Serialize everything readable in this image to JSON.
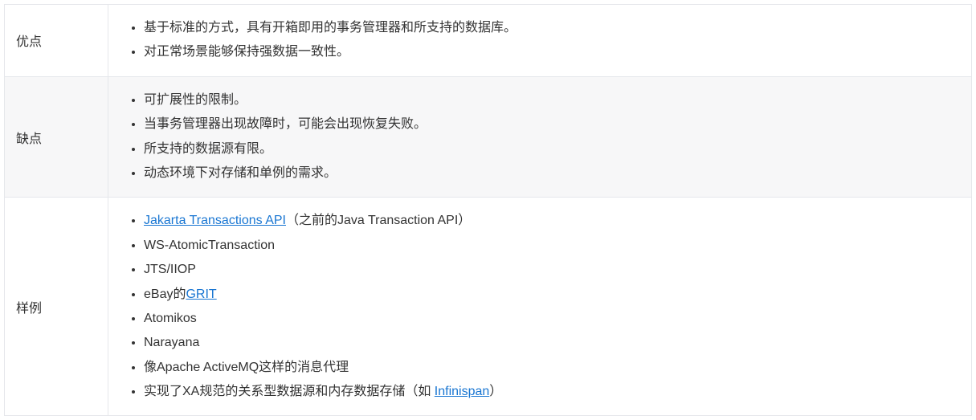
{
  "rows": [
    {
      "label": "优点",
      "shaded": false,
      "items": [
        {
          "parts": [
            {
              "type": "text",
              "value": "基于标准的方式，具有开箱即用的事务管理器和所支持的数据库。"
            }
          ]
        },
        {
          "parts": [
            {
              "type": "text",
              "value": "对正常场景能够保持强数据一致性。"
            }
          ]
        }
      ]
    },
    {
      "label": "缺点",
      "shaded": true,
      "items": [
        {
          "parts": [
            {
              "type": "text",
              "value": "可扩展性的限制。"
            }
          ]
        },
        {
          "parts": [
            {
              "type": "text",
              "value": "当事务管理器出现故障时，可能会出现恢复失败。"
            }
          ]
        },
        {
          "parts": [
            {
              "type": "text",
              "value": "所支持的数据源有限。"
            }
          ]
        },
        {
          "parts": [
            {
              "type": "text",
              "value": "动态环境下对存储和单例的需求。"
            }
          ]
        }
      ]
    },
    {
      "label": "样例",
      "shaded": false,
      "items": [
        {
          "parts": [
            {
              "type": "link",
              "value": "Jakarta Transactions API"
            },
            {
              "type": "text",
              "value": "（之前的Java Transaction API）"
            }
          ]
        },
        {
          "parts": [
            {
              "type": "text",
              "value": "WS-AtomicTransaction"
            }
          ]
        },
        {
          "parts": [
            {
              "type": "text",
              "value": "JTS/IIOP"
            }
          ]
        },
        {
          "parts": [
            {
              "type": "text",
              "value": "eBay的"
            },
            {
              "type": "link",
              "value": "GRIT"
            }
          ]
        },
        {
          "parts": [
            {
              "type": "text",
              "value": "Atomikos"
            }
          ]
        },
        {
          "parts": [
            {
              "type": "text",
              "value": "Narayana"
            }
          ]
        },
        {
          "parts": [
            {
              "type": "text",
              "value": "像Apache ActiveMQ这样的消息代理"
            }
          ]
        },
        {
          "parts": [
            {
              "type": "text",
              "value": "实现了XA规范的关系型数据源和内存数据存储（如 "
            },
            {
              "type": "link",
              "value": "Infinispan"
            },
            {
              "type": "text",
              "value": "）"
            }
          ]
        }
      ]
    }
  ]
}
